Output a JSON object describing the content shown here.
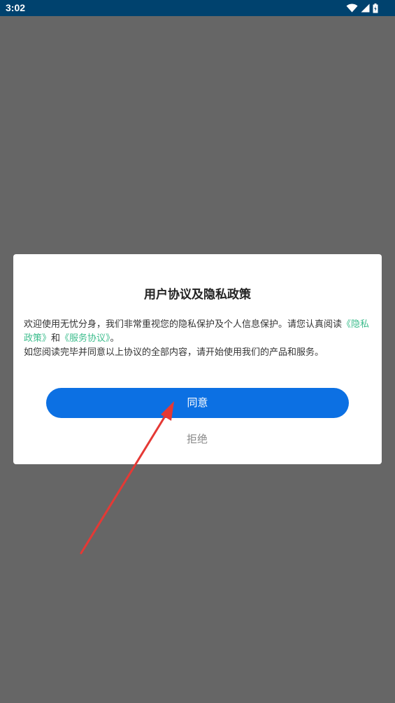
{
  "status_bar": {
    "time": "3:02",
    "icons": [
      "wifi-icon",
      "cellular-signal-icon",
      "battery-icon"
    ]
  },
  "dialog": {
    "title": "用户协议及隐私政策",
    "body": {
      "text_before": "欢迎使用无忧分身，我们非常重视您的隐私保护及个人信息保护。请您认真阅读",
      "privacy_link": "《隐私政策》",
      "conjunction": "和",
      "service_link": "《服务协议》",
      "text_after": "。",
      "second_paragraph": "如您阅读完毕并同意以上协议的全部内容，请开始使用我们的产品和服务。"
    },
    "agree_label": "同意",
    "reject_label": "拒绝"
  },
  "colors": {
    "status_bar": "#00426e",
    "overlay": "#666666",
    "accent_button": "#0c70e3",
    "link": "#3dbd8d",
    "annotation_arrow": "#e53935"
  }
}
